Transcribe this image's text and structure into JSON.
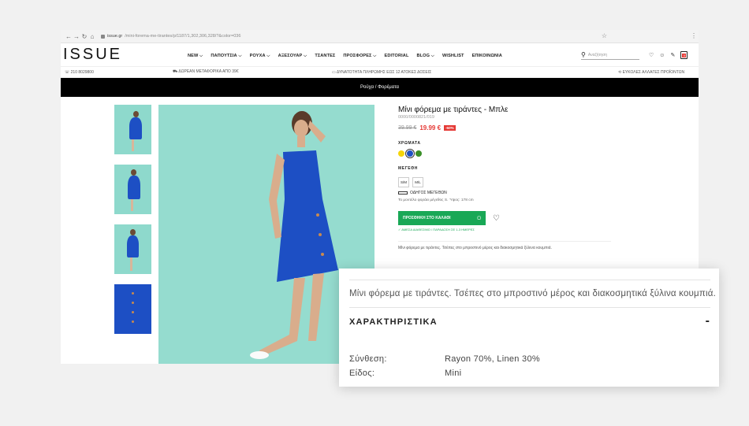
{
  "browser": {
    "url_host": "issue.gr",
    "url_path": "/mini-forema-me-tirantes/p/1187/1,302,306,328/?&color=036"
  },
  "site": {
    "logo": "ISSUE",
    "nav": [
      "NEW ⌵",
      "ΠΑΠΟΥΤΣΙΑ ⌵",
      "ΡΟΥΧΑ ⌵",
      "ΑΞΕΣΟΥΑΡ ⌵",
      "ΤΣΑΝΤΕΣ",
      "ΠΡΟΣΦΟΡΕΣ ⌵",
      "EDITORIAL",
      "BLOG ⌵",
      "WISHLIST",
      "ΕΠΙΚΟΙΝΩΝΙΑ"
    ],
    "search_placeholder": "Αναζήτηση",
    "cart_count": "0"
  },
  "infobar": {
    "phone": "210 8029800",
    "shipping": "ΔΩΡΕΑΝ ΜΕΤΑΦΟΡΙΚΑ ΑΠΟ 39€",
    "installments": "ΔΥΝΑΤΟΤΗΤΑ ΠΛΗΡΩΜΗΣ ΕΩΣ 12 ΑΤΟΚΕΣ ΔΟΣΕΙΣ",
    "returns": "ΕΥΚΟΛΕΣ ΑΛΛΑΓΕΣ ΠΡΟΪΟΝΤΩΝ"
  },
  "breadcrumb": "Ρούχα / Φορέματα",
  "product": {
    "title": "Μίνι φόρεμα με τιράντες - Μπλε",
    "sku": "0000/0000821/019",
    "old_price": "39.99 €",
    "new_price": "19.99 €",
    "discount": "-50%",
    "colors_label": "ΧΡΩΜΑΤΑ",
    "colors": [
      "#f5d50a",
      "#1d4fc4",
      "#3a8f28"
    ],
    "sizes_label": "ΜΕΓΕΘΗ",
    "sizes": [
      "S/M",
      "M/L"
    ],
    "size_guide": "ΟΔΗΓΟΣ ΜΕΓΕΘΩΝ",
    "model_info": "Το μοντέλο φοράει μέγεθος S. Ύψος: 178 cm",
    "add_to_cart": "ΠΡΟΣΘΗΚΗ ΣΤΟ ΚΑΛΑΘΙ",
    "shipping_note": "ΑΜΕΣΑ ΔΙΑΘΕΣΙΜΟ / ΠΑΡΑΔΟΣΗ ΣΕ 1-3 ΗΜΕΡΕΣ",
    "short_description": "Μίνι φόρεμα με τιράντες. Τσέπες στο μπροστινό μέρος και διακοσμητικά ξύλινα κουμπιά."
  },
  "zoom_panel": {
    "description": "Μίνι φόρεμα με τιράντες. Τσέπες στο μπροστινό μέρος και διακοσμητικά ξύλινα κουμπιά.",
    "section_title": "ΧΑΡΑΚΤΗΡΙΣΤΙΚΑ",
    "toggle": "-",
    "specs": [
      {
        "label": "Σύνθεση:",
        "value": "Rayon 70%, Linen 30%"
      },
      {
        "label": "Είδος:",
        "value": "Mini"
      }
    ]
  }
}
